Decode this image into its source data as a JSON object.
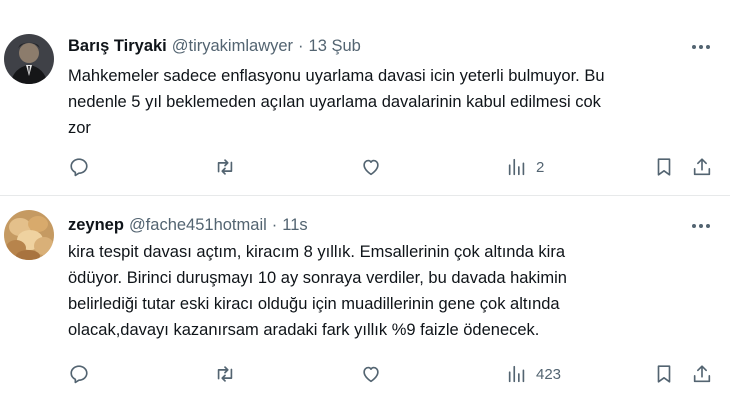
{
  "tweets": [
    {
      "name": "Barış Tiryaki",
      "handle": "@tiryakimlawyer",
      "separator": "·",
      "time": "13 Şub",
      "lines": [
        "Mahkemeler sadece enflasyonu uyarlama davasi icin yeterli bulmuyor. Bu",
        "nedenle 5 yıl beklemeden açılan uyarlama davalarinin kabul edilmesi cok",
        "zor"
      ],
      "views": "2",
      "avatar": "avatar-photo"
    },
    {
      "name": "zeynep",
      "handle": "@fache451hotmail",
      "separator": "·",
      "time": "11s",
      "lines": [
        "kira tespit davası açtım, kiracım 8 yıllık. Emsallerinin çok altında kira",
        "ödüyor. Birinci duruşmayı 10 ay sonraya verdiler, bu davada hakimin",
        "belirlediği tutar eski kiracı olduğu için muadillerinin gene çok altında",
        "olacak,davayı kazanırsam aradaki fark yıllık %9 faizle ödenecek."
      ],
      "views": "423",
      "avatar": "avatar-photo"
    }
  ],
  "icons": {
    "more": "more-horizontal-icon",
    "reply": "reply-icon",
    "retweet": "retweet-icon",
    "like": "heart-icon",
    "views": "views-chart-icon",
    "bookmark": "bookmark-icon",
    "share": "share-icon"
  },
  "colors": {
    "text": "#0f1419",
    "secondary": "#536471",
    "divider": "#e7e9ea",
    "background": "#ffffff"
  }
}
